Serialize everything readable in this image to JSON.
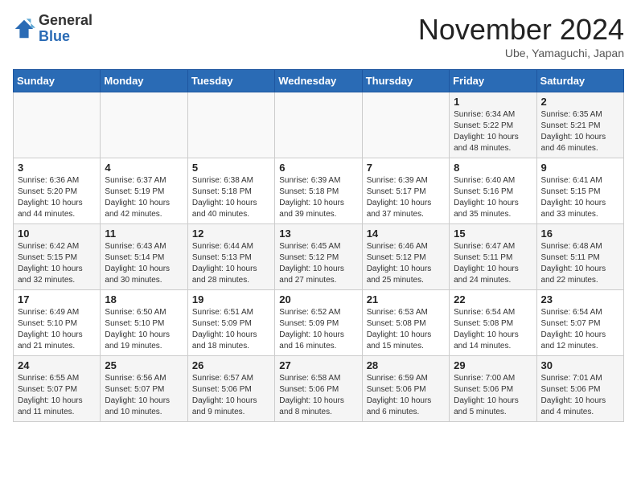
{
  "header": {
    "logo_general": "General",
    "logo_blue": "Blue",
    "month": "November 2024",
    "location": "Ube, Yamaguchi, Japan"
  },
  "weekdays": [
    "Sunday",
    "Monday",
    "Tuesday",
    "Wednesday",
    "Thursday",
    "Friday",
    "Saturday"
  ],
  "weeks": [
    [
      {
        "day": "",
        "info": ""
      },
      {
        "day": "",
        "info": ""
      },
      {
        "day": "",
        "info": ""
      },
      {
        "day": "",
        "info": ""
      },
      {
        "day": "",
        "info": ""
      },
      {
        "day": "1",
        "info": "Sunrise: 6:34 AM\nSunset: 5:22 PM\nDaylight: 10 hours\nand 48 minutes."
      },
      {
        "day": "2",
        "info": "Sunrise: 6:35 AM\nSunset: 5:21 PM\nDaylight: 10 hours\nand 46 minutes."
      }
    ],
    [
      {
        "day": "3",
        "info": "Sunrise: 6:36 AM\nSunset: 5:20 PM\nDaylight: 10 hours\nand 44 minutes."
      },
      {
        "day": "4",
        "info": "Sunrise: 6:37 AM\nSunset: 5:19 PM\nDaylight: 10 hours\nand 42 minutes."
      },
      {
        "day": "5",
        "info": "Sunrise: 6:38 AM\nSunset: 5:18 PM\nDaylight: 10 hours\nand 40 minutes."
      },
      {
        "day": "6",
        "info": "Sunrise: 6:39 AM\nSunset: 5:18 PM\nDaylight: 10 hours\nand 39 minutes."
      },
      {
        "day": "7",
        "info": "Sunrise: 6:39 AM\nSunset: 5:17 PM\nDaylight: 10 hours\nand 37 minutes."
      },
      {
        "day": "8",
        "info": "Sunrise: 6:40 AM\nSunset: 5:16 PM\nDaylight: 10 hours\nand 35 minutes."
      },
      {
        "day": "9",
        "info": "Sunrise: 6:41 AM\nSunset: 5:15 PM\nDaylight: 10 hours\nand 33 minutes."
      }
    ],
    [
      {
        "day": "10",
        "info": "Sunrise: 6:42 AM\nSunset: 5:15 PM\nDaylight: 10 hours\nand 32 minutes."
      },
      {
        "day": "11",
        "info": "Sunrise: 6:43 AM\nSunset: 5:14 PM\nDaylight: 10 hours\nand 30 minutes."
      },
      {
        "day": "12",
        "info": "Sunrise: 6:44 AM\nSunset: 5:13 PM\nDaylight: 10 hours\nand 28 minutes."
      },
      {
        "day": "13",
        "info": "Sunrise: 6:45 AM\nSunset: 5:12 PM\nDaylight: 10 hours\nand 27 minutes."
      },
      {
        "day": "14",
        "info": "Sunrise: 6:46 AM\nSunset: 5:12 PM\nDaylight: 10 hours\nand 25 minutes."
      },
      {
        "day": "15",
        "info": "Sunrise: 6:47 AM\nSunset: 5:11 PM\nDaylight: 10 hours\nand 24 minutes."
      },
      {
        "day": "16",
        "info": "Sunrise: 6:48 AM\nSunset: 5:11 PM\nDaylight: 10 hours\nand 22 minutes."
      }
    ],
    [
      {
        "day": "17",
        "info": "Sunrise: 6:49 AM\nSunset: 5:10 PM\nDaylight: 10 hours\nand 21 minutes."
      },
      {
        "day": "18",
        "info": "Sunrise: 6:50 AM\nSunset: 5:10 PM\nDaylight: 10 hours\nand 19 minutes."
      },
      {
        "day": "19",
        "info": "Sunrise: 6:51 AM\nSunset: 5:09 PM\nDaylight: 10 hours\nand 18 minutes."
      },
      {
        "day": "20",
        "info": "Sunrise: 6:52 AM\nSunset: 5:09 PM\nDaylight: 10 hours\nand 16 minutes."
      },
      {
        "day": "21",
        "info": "Sunrise: 6:53 AM\nSunset: 5:08 PM\nDaylight: 10 hours\nand 15 minutes."
      },
      {
        "day": "22",
        "info": "Sunrise: 6:54 AM\nSunset: 5:08 PM\nDaylight: 10 hours\nand 14 minutes."
      },
      {
        "day": "23",
        "info": "Sunrise: 6:54 AM\nSunset: 5:07 PM\nDaylight: 10 hours\nand 12 minutes."
      }
    ],
    [
      {
        "day": "24",
        "info": "Sunrise: 6:55 AM\nSunset: 5:07 PM\nDaylight: 10 hours\nand 11 minutes."
      },
      {
        "day": "25",
        "info": "Sunrise: 6:56 AM\nSunset: 5:07 PM\nDaylight: 10 hours\nand 10 minutes."
      },
      {
        "day": "26",
        "info": "Sunrise: 6:57 AM\nSunset: 5:06 PM\nDaylight: 10 hours\nand 9 minutes."
      },
      {
        "day": "27",
        "info": "Sunrise: 6:58 AM\nSunset: 5:06 PM\nDaylight: 10 hours\nand 8 minutes."
      },
      {
        "day": "28",
        "info": "Sunrise: 6:59 AM\nSunset: 5:06 PM\nDaylight: 10 hours\nand 6 minutes."
      },
      {
        "day": "29",
        "info": "Sunrise: 7:00 AM\nSunset: 5:06 PM\nDaylight: 10 hours\nand 5 minutes."
      },
      {
        "day": "30",
        "info": "Sunrise: 7:01 AM\nSunset: 5:06 PM\nDaylight: 10 hours\nand 4 minutes."
      }
    ]
  ]
}
